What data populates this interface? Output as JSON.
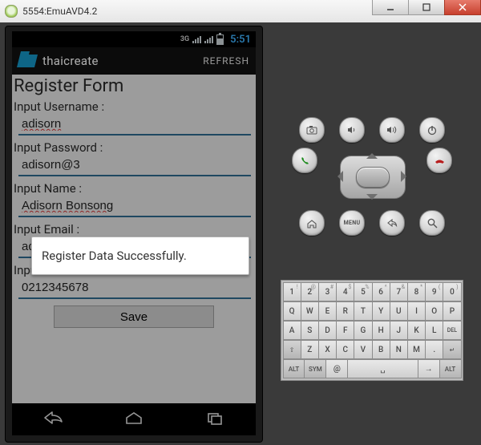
{
  "window": {
    "title": "5554:EmuAVD4.2"
  },
  "statusbar": {
    "net": "3G",
    "time": "5:51"
  },
  "actionbar": {
    "app_title": "thaicreate",
    "refresh": "REFRESH"
  },
  "form": {
    "heading": "Register Form",
    "username_label": "Input Username :",
    "username_value": "adisorn",
    "password_label": "Input Password :",
    "password_value": "adisorn@3",
    "name_label": "Input Name :",
    "name_value": "Adisorn Bonsong",
    "email_label": "Input Email :",
    "email_value": "adisorn@thaicreate.com",
    "tel_label": "Input Tel :",
    "tel_value": "0212345678",
    "save": "Save"
  },
  "toast": {
    "message": "Register Data Successfully."
  },
  "side_buttons": {
    "row1": [
      "camera",
      "vol-down",
      "vol-up",
      "power"
    ],
    "row2": [
      "call",
      "dpad",
      "end-call"
    ],
    "row3": [
      "home",
      "menu",
      "back",
      "search"
    ],
    "menu_label": "MENU"
  },
  "keyboard": {
    "row1": [
      {
        "m": "1",
        "s": "!"
      },
      {
        "m": "2",
        "s": "@"
      },
      {
        "m": "3",
        "s": "#"
      },
      {
        "m": "4",
        "s": "$"
      },
      {
        "m": "5",
        "s": "%"
      },
      {
        "m": "6",
        "s": "^"
      },
      {
        "m": "7",
        "s": "&"
      },
      {
        "m": "8",
        "s": "*"
      },
      {
        "m": "9",
        "s": "("
      },
      {
        "m": "0",
        "s": ")"
      }
    ],
    "row2": [
      {
        "m": "Q"
      },
      {
        "m": "W"
      },
      {
        "m": "E"
      },
      {
        "m": "R"
      },
      {
        "m": "T"
      },
      {
        "m": "Y"
      },
      {
        "m": "U"
      },
      {
        "m": "I"
      },
      {
        "m": "O"
      },
      {
        "m": "P"
      }
    ],
    "row3": [
      {
        "m": "A"
      },
      {
        "m": "S"
      },
      {
        "m": "D"
      },
      {
        "m": "F"
      },
      {
        "m": "G"
      },
      {
        "m": "H"
      },
      {
        "m": "J"
      },
      {
        "m": "K"
      },
      {
        "m": "L"
      },
      {
        "m": "DEL",
        "cls": "del"
      }
    ],
    "row4": [
      {
        "m": "⇧",
        "cls": "alt"
      },
      {
        "m": "Z"
      },
      {
        "m": "X"
      },
      {
        "m": "C"
      },
      {
        "m": "V"
      },
      {
        "m": "B"
      },
      {
        "m": "N"
      },
      {
        "m": "M"
      },
      {
        "m": "."
      },
      {
        "m": "↵",
        "cls": "alt"
      }
    ],
    "row5": [
      {
        "m": "ALT",
        "cls": "alt wide"
      },
      {
        "m": "SYM",
        "cls": "alt wide"
      },
      {
        "m": "@",
        "cls": "wide"
      },
      {
        "m": "␣",
        "cls": "xwide"
      },
      {
        "m": "→",
        "cls": "wide"
      },
      {
        "m": "ALT",
        "cls": "alt wide"
      }
    ]
  }
}
